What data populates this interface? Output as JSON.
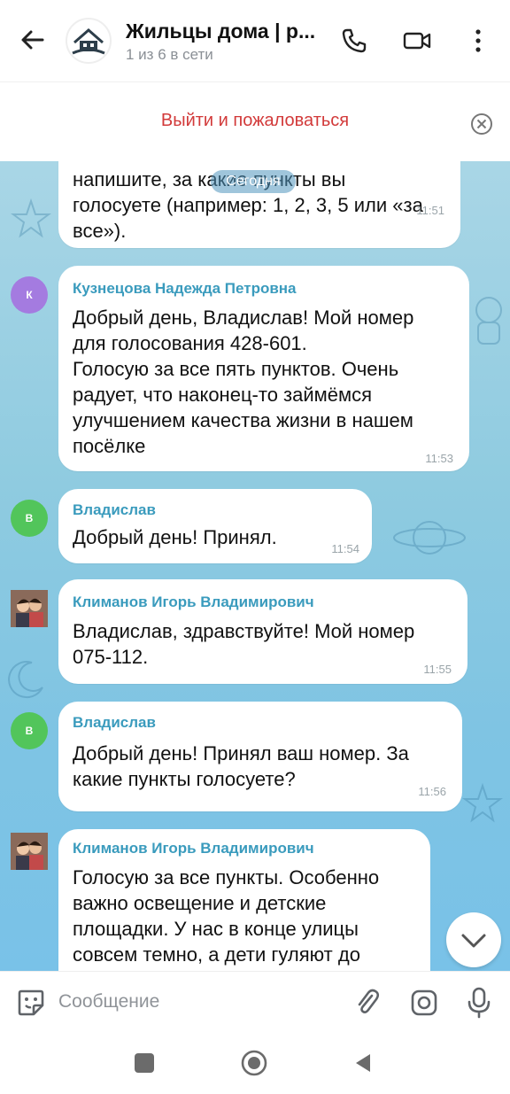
{
  "header": {
    "title": "Жильцы дома | р...",
    "subtitle": "1 из 6 в сети"
  },
  "report_bar": {
    "label": "Выйти и пожаловаться"
  },
  "chat": {
    "date_chip": "Сегодня",
    "messages": [
      {
        "text": "напишите, за какие пункты вы\nголосуете (например: 1, 2, 3, 5 или «за\nвсе»).",
        "time": "11:51"
      },
      {
        "avatar_letter": "К",
        "avatar_color": "#a47be0",
        "sender": "Кузнецова Надежда Петровна",
        "text": "Добрый день, Владислав! Мой номер\nдля голосования 428-601.\nГолосую за все пять пунктов. Очень\nрадует, что наконец-то займёмся\nулучшением качества жизни в нашем\nпосёлке",
        "time": "11:53"
      },
      {
        "avatar_letter": "В",
        "avatar_color": "#52c55b",
        "sender": "Владислав",
        "text": "Добрый день! Принял.",
        "time": "11:54"
      },
      {
        "sender": "Климанов Игорь Владимирович",
        "text": "Владислав, здравствуйте! Мой номер\n075-112.",
        "time": "11:55"
      },
      {
        "avatar_letter": "В",
        "avatar_color": "#52c55b",
        "sender": "Владислав",
        "text": "Добрый день! Принял ваш номер. За\nкакие пункты голосуете?",
        "time": "11:56"
      },
      {
        "sender": "Климанов Игорь Владимирович",
        "text": "Голосую за все пункты. Особенно\nважно освещение и детские\nплощадки. У нас в конце улицы\nсовсем темно, а дети гуляют до"
      }
    ]
  },
  "composer": {
    "placeholder": "Сообщение"
  },
  "colors": {
    "accent": "#3a9bbd",
    "report_red": "#d23a3a",
    "icon_gray": "#5f6368"
  }
}
